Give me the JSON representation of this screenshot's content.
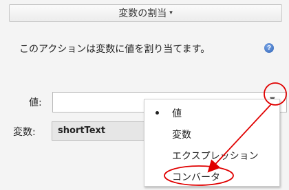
{
  "header": {
    "title": "変数の割当",
    "caret": "▾"
  },
  "description": "このアクションは変数に値を割り当てます。",
  "help_icon": "?",
  "fields": {
    "value_label": "値:",
    "value_input": "",
    "variable_label": "変数:",
    "variable_value": "shortText"
  },
  "dropdown": {
    "arrow": "▼",
    "items": [
      {
        "label": "値",
        "selected": true
      },
      {
        "label": "変数",
        "selected": false
      },
      {
        "label": "エクスプレッション",
        "selected": false
      },
      {
        "label": "コンバータ",
        "selected": false
      }
    ]
  },
  "annotation_color": "#e00000"
}
